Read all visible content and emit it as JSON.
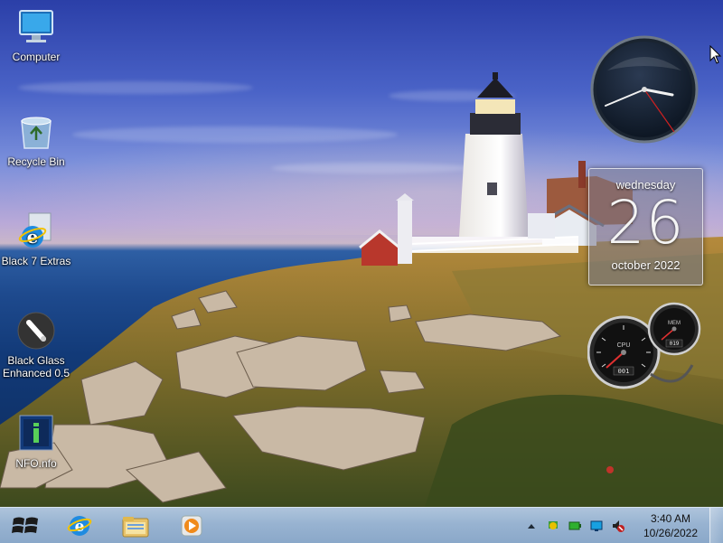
{
  "desktop_icons": [
    {
      "label": "Computer",
      "icon": "computer-icon"
    },
    {
      "label": "Recycle Bin",
      "icon": "recycle-bin-icon"
    },
    {
      "label": "Black 7 Extras",
      "icon": "internet-explorer-icon"
    },
    {
      "label": "Black Glass Enhanced 0.5",
      "icon": "brush-icon"
    },
    {
      "label": "NFO.nfo",
      "icon": "nfo-file-icon"
    }
  ],
  "calendar": {
    "weekday": "wednesday",
    "day": "26",
    "month_year": "october 2022"
  },
  "meter": {
    "cpu_label": "CPU",
    "cpu_value": "001",
    "mem_label": "MEM",
    "mem_value": "019"
  },
  "taskbar": {
    "pinned": [
      {
        "name": "internet-explorer-icon"
      },
      {
        "name": "file-explorer-icon"
      },
      {
        "name": "media-player-icon"
      }
    ],
    "tray_icons": [
      "show-hidden-icons-arrow-icon",
      "network-icon",
      "battery-icon",
      "display-icon",
      "volume-icon"
    ],
    "clock_time": "3:40 AM",
    "clock_date": "10/26/2022"
  },
  "colors": {
    "taskbar": "#98b3d1",
    "sky": "#4a63c7",
    "sea": "#1e4a8e"
  }
}
